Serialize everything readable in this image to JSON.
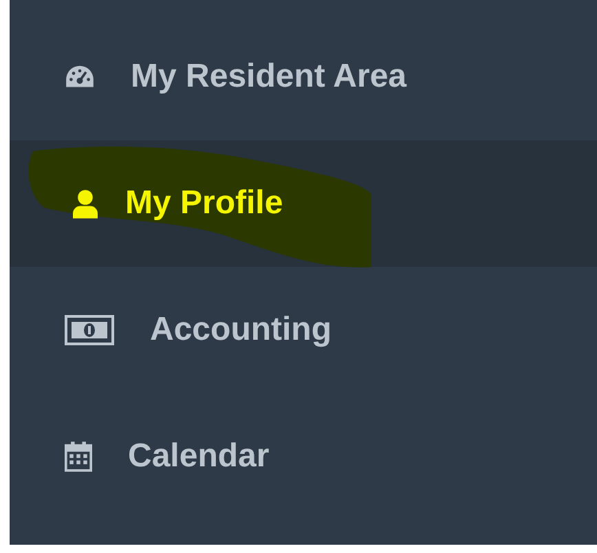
{
  "sidebar": {
    "items": [
      {
        "label": "My Resident Area",
        "selected": false
      },
      {
        "label": "My Profile",
        "selected": true
      },
      {
        "label": "Accounting",
        "selected": false
      },
      {
        "label": "Calendar",
        "selected": false
      }
    ]
  }
}
